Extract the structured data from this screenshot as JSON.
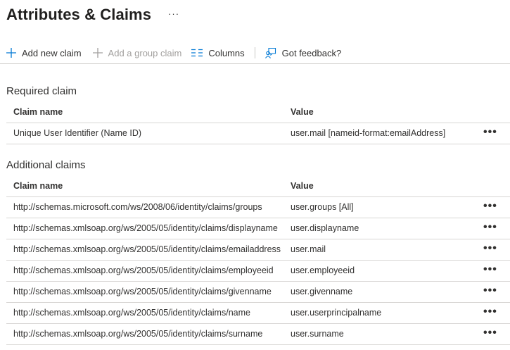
{
  "page": {
    "title": "Attributes & Claims",
    "title_more": "···"
  },
  "toolbar": {
    "add_new_claim": "Add new claim",
    "add_group_claim": "Add a group claim",
    "columns": "Columns",
    "feedback": "Got feedback?"
  },
  "required": {
    "section_title": "Required claim",
    "col_claim": "Claim name",
    "col_value": "Value",
    "rows": [
      {
        "claim": "Unique User Identifier (Name ID)",
        "value": "user.mail [nameid-format:emailAddress]"
      }
    ]
  },
  "additional": {
    "section_title": "Additional claims",
    "col_claim": "Claim name",
    "col_value": "Value",
    "rows": [
      {
        "claim": "http://schemas.microsoft.com/ws/2008/06/identity/claims/groups",
        "value": "user.groups [All]"
      },
      {
        "claim": "http://schemas.xmlsoap.org/ws/2005/05/identity/claims/displayname",
        "value": "user.displayname"
      },
      {
        "claim": "http://schemas.xmlsoap.org/ws/2005/05/identity/claims/emailaddress",
        "value": "user.mail"
      },
      {
        "claim": "http://schemas.xmlsoap.org/ws/2005/05/identity/claims/employeeid",
        "value": "user.employeeid"
      },
      {
        "claim": "http://schemas.xmlsoap.org/ws/2005/05/identity/claims/givenname",
        "value": "user.givenname"
      },
      {
        "claim": "http://schemas.xmlsoap.org/ws/2005/05/identity/claims/name",
        "value": "user.userprincipalname"
      },
      {
        "claim": "http://schemas.xmlsoap.org/ws/2005/05/identity/claims/surname",
        "value": "user.surname"
      }
    ]
  },
  "row_more_label": "•••",
  "colors": {
    "accent": "#0078d4",
    "disabled": "#a19f9d",
    "text": "#323130"
  },
  "icons": {
    "add": "add-icon",
    "columns": "columns-icon",
    "feedback": "feedback-icon",
    "more": "more-icon"
  }
}
